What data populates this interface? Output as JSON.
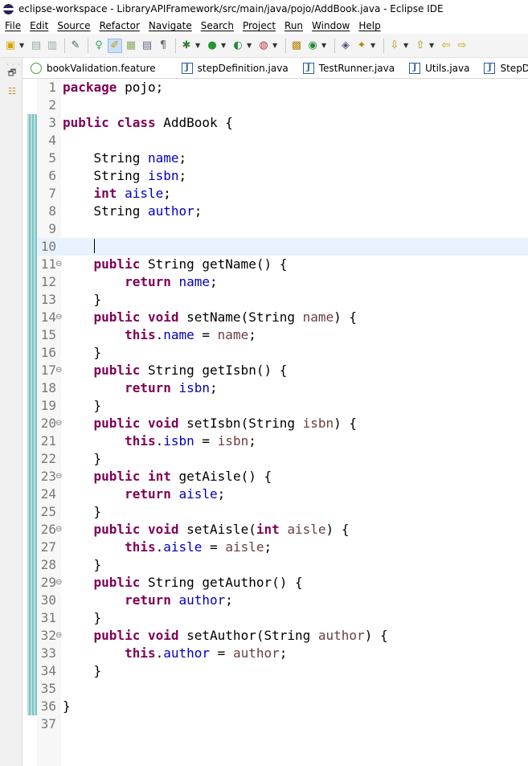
{
  "window": {
    "title": "eclipse-workspace - LibraryAPIFramework/src/main/java/pojo/AddBook.java - Eclipse IDE"
  },
  "menu": [
    "File",
    "Edit",
    "Source",
    "Refactor",
    "Navigate",
    "Search",
    "Project",
    "Run",
    "Window",
    "Help"
  ],
  "tabs": [
    {
      "label": "bookValidation.feature",
      "icon": "cucumber-feature-icon"
    },
    {
      "label": "stepDefinition.java",
      "icon": "java-file-icon"
    },
    {
      "label": "TestRunner.java",
      "icon": "java-file-icon"
    },
    {
      "label": "Utils.java",
      "icon": "java-file-icon"
    },
    {
      "label": "StepDefini",
      "icon": "java-file-icon"
    }
  ],
  "editor": {
    "current_line": 10,
    "lines": [
      {
        "n": "1",
        "fold": "",
        "tokens": [
          {
            "t": "kw",
            "v": "package"
          },
          {
            "t": "",
            "v": " pojo;"
          }
        ]
      },
      {
        "n": "2",
        "fold": "",
        "tokens": []
      },
      {
        "n": "3",
        "fold": "",
        "tokens": [
          {
            "t": "kw",
            "v": "public"
          },
          {
            "t": "",
            "v": " "
          },
          {
            "t": "kw",
            "v": "class"
          },
          {
            "t": "",
            "v": " AddBook {"
          }
        ]
      },
      {
        "n": "4",
        "fold": "",
        "tokens": []
      },
      {
        "n": "5",
        "fold": "",
        "tokens": [
          {
            "t": "",
            "v": "    String "
          },
          {
            "t": "fld",
            "v": "name"
          },
          {
            "t": "",
            "v": ";"
          }
        ]
      },
      {
        "n": "6",
        "fold": "",
        "tokens": [
          {
            "t": "",
            "v": "    String "
          },
          {
            "t": "fld",
            "v": "isbn"
          },
          {
            "t": "",
            "v": ";"
          }
        ]
      },
      {
        "n": "7",
        "fold": "",
        "tokens": [
          {
            "t": "",
            "v": "    "
          },
          {
            "t": "kw",
            "v": "int"
          },
          {
            "t": "",
            "v": " "
          },
          {
            "t": "fld",
            "v": "aisle"
          },
          {
            "t": "",
            "v": ";"
          }
        ]
      },
      {
        "n": "8",
        "fold": "",
        "tokens": [
          {
            "t": "",
            "v": "    String "
          },
          {
            "t": "fld",
            "v": "author"
          },
          {
            "t": "",
            "v": ";"
          }
        ]
      },
      {
        "n": "9",
        "fold": "",
        "tokens": []
      },
      {
        "n": "10",
        "fold": "",
        "tokens": [
          {
            "t": "",
            "v": "    "
          }
        ]
      },
      {
        "n": "11",
        "fold": "⊖",
        "tokens": [
          {
            "t": "",
            "v": "    "
          },
          {
            "t": "kw",
            "v": "public"
          },
          {
            "t": "",
            "v": " String getName() {"
          }
        ]
      },
      {
        "n": "12",
        "fold": "",
        "tokens": [
          {
            "t": "",
            "v": "        "
          },
          {
            "t": "kw",
            "v": "return"
          },
          {
            "t": "",
            "v": " "
          },
          {
            "t": "fld",
            "v": "name"
          },
          {
            "t": "",
            "v": ";"
          }
        ]
      },
      {
        "n": "13",
        "fold": "",
        "tokens": [
          {
            "t": "",
            "v": "    }"
          }
        ]
      },
      {
        "n": "14",
        "fold": "⊖",
        "tokens": [
          {
            "t": "",
            "v": "    "
          },
          {
            "t": "kw",
            "v": "public"
          },
          {
            "t": "",
            "v": " "
          },
          {
            "t": "kw",
            "v": "void"
          },
          {
            "t": "",
            "v": " setName(String "
          },
          {
            "t": "prm",
            "v": "name"
          },
          {
            "t": "",
            "v": ") {"
          }
        ]
      },
      {
        "n": "15",
        "fold": "",
        "tokens": [
          {
            "t": "",
            "v": "        "
          },
          {
            "t": "kw",
            "v": "this"
          },
          {
            "t": "",
            "v": "."
          },
          {
            "t": "fld",
            "v": "name"
          },
          {
            "t": "",
            "v": " = "
          },
          {
            "t": "prm",
            "v": "name"
          },
          {
            "t": "",
            "v": ";"
          }
        ]
      },
      {
        "n": "16",
        "fold": "",
        "tokens": [
          {
            "t": "",
            "v": "    }"
          }
        ]
      },
      {
        "n": "17",
        "fold": "⊖",
        "tokens": [
          {
            "t": "",
            "v": "    "
          },
          {
            "t": "kw",
            "v": "public"
          },
          {
            "t": "",
            "v": " String getIsbn() {"
          }
        ]
      },
      {
        "n": "18",
        "fold": "",
        "tokens": [
          {
            "t": "",
            "v": "        "
          },
          {
            "t": "kw",
            "v": "return"
          },
          {
            "t": "",
            "v": " "
          },
          {
            "t": "fld",
            "v": "isbn"
          },
          {
            "t": "",
            "v": ";"
          }
        ]
      },
      {
        "n": "19",
        "fold": "",
        "tokens": [
          {
            "t": "",
            "v": "    }"
          }
        ]
      },
      {
        "n": "20",
        "fold": "⊖",
        "tokens": [
          {
            "t": "",
            "v": "    "
          },
          {
            "t": "kw",
            "v": "public"
          },
          {
            "t": "",
            "v": " "
          },
          {
            "t": "kw",
            "v": "void"
          },
          {
            "t": "",
            "v": " setIsbn(String "
          },
          {
            "t": "prm",
            "v": "isbn"
          },
          {
            "t": "",
            "v": ") {"
          }
        ]
      },
      {
        "n": "21",
        "fold": "",
        "tokens": [
          {
            "t": "",
            "v": "        "
          },
          {
            "t": "kw",
            "v": "this"
          },
          {
            "t": "",
            "v": "."
          },
          {
            "t": "fld",
            "v": "isbn"
          },
          {
            "t": "",
            "v": " = "
          },
          {
            "t": "prm",
            "v": "isbn"
          },
          {
            "t": "",
            "v": ";"
          }
        ]
      },
      {
        "n": "22",
        "fold": "",
        "tokens": [
          {
            "t": "",
            "v": "    }"
          }
        ]
      },
      {
        "n": "23",
        "fold": "⊖",
        "tokens": [
          {
            "t": "",
            "v": "    "
          },
          {
            "t": "kw",
            "v": "public"
          },
          {
            "t": "",
            "v": " "
          },
          {
            "t": "kw",
            "v": "int"
          },
          {
            "t": "",
            "v": " getAisle() {"
          }
        ]
      },
      {
        "n": "24",
        "fold": "",
        "tokens": [
          {
            "t": "",
            "v": "        "
          },
          {
            "t": "kw",
            "v": "return"
          },
          {
            "t": "",
            "v": " "
          },
          {
            "t": "fld",
            "v": "aisle"
          },
          {
            "t": "",
            "v": ";"
          }
        ]
      },
      {
        "n": "25",
        "fold": "",
        "tokens": [
          {
            "t": "",
            "v": "    }"
          }
        ]
      },
      {
        "n": "26",
        "fold": "⊖",
        "tokens": [
          {
            "t": "",
            "v": "    "
          },
          {
            "t": "kw",
            "v": "public"
          },
          {
            "t": "",
            "v": " "
          },
          {
            "t": "kw",
            "v": "void"
          },
          {
            "t": "",
            "v": " setAisle("
          },
          {
            "t": "kw",
            "v": "int"
          },
          {
            "t": "",
            "v": " "
          },
          {
            "t": "prm",
            "v": "aisle"
          },
          {
            "t": "",
            "v": ") {"
          }
        ]
      },
      {
        "n": "27",
        "fold": "",
        "tokens": [
          {
            "t": "",
            "v": "        "
          },
          {
            "t": "kw",
            "v": "this"
          },
          {
            "t": "",
            "v": "."
          },
          {
            "t": "fld",
            "v": "aisle"
          },
          {
            "t": "",
            "v": " = "
          },
          {
            "t": "prm",
            "v": "aisle"
          },
          {
            "t": "",
            "v": ";"
          }
        ]
      },
      {
        "n": "28",
        "fold": "",
        "tokens": [
          {
            "t": "",
            "v": "    }"
          }
        ]
      },
      {
        "n": "29",
        "fold": "⊖",
        "tokens": [
          {
            "t": "",
            "v": "    "
          },
          {
            "t": "kw",
            "v": "public"
          },
          {
            "t": "",
            "v": " String getAuthor() {"
          }
        ]
      },
      {
        "n": "30",
        "fold": "",
        "tokens": [
          {
            "t": "",
            "v": "        "
          },
          {
            "t": "kw",
            "v": "return"
          },
          {
            "t": "",
            "v": " "
          },
          {
            "t": "fld",
            "v": "author"
          },
          {
            "t": "",
            "v": ";"
          }
        ]
      },
      {
        "n": "31",
        "fold": "",
        "tokens": [
          {
            "t": "",
            "v": "    }"
          }
        ]
      },
      {
        "n": "32",
        "fold": "⊖",
        "tokens": [
          {
            "t": "",
            "v": "    "
          },
          {
            "t": "kw",
            "v": "public"
          },
          {
            "t": "",
            "v": " "
          },
          {
            "t": "kw",
            "v": "void"
          },
          {
            "t": "",
            "v": " setAuthor(String "
          },
          {
            "t": "prm",
            "v": "author"
          },
          {
            "t": "",
            "v": ") {"
          }
        ]
      },
      {
        "n": "33",
        "fold": "",
        "tokens": [
          {
            "t": "",
            "v": "        "
          },
          {
            "t": "kw",
            "v": "this"
          },
          {
            "t": "",
            "v": "."
          },
          {
            "t": "fld",
            "v": "author"
          },
          {
            "t": "",
            "v": " = "
          },
          {
            "t": "prm",
            "v": "author"
          },
          {
            "t": "",
            "v": ";"
          }
        ]
      },
      {
        "n": "34",
        "fold": "",
        "tokens": [
          {
            "t": "",
            "v": "    }"
          }
        ]
      },
      {
        "n": "35",
        "fold": "",
        "tokens": []
      },
      {
        "n": "36",
        "fold": "",
        "tokens": [
          {
            "t": "",
            "v": "}"
          }
        ]
      },
      {
        "n": "37",
        "fold": "",
        "tokens": []
      }
    ]
  },
  "colors": {
    "keyword": "#7f0055",
    "field": "#0000c0",
    "parameter": "#6a3e3e",
    "current_line_bg": "#e8f2fe",
    "change_bar": "#7cc5c5"
  }
}
